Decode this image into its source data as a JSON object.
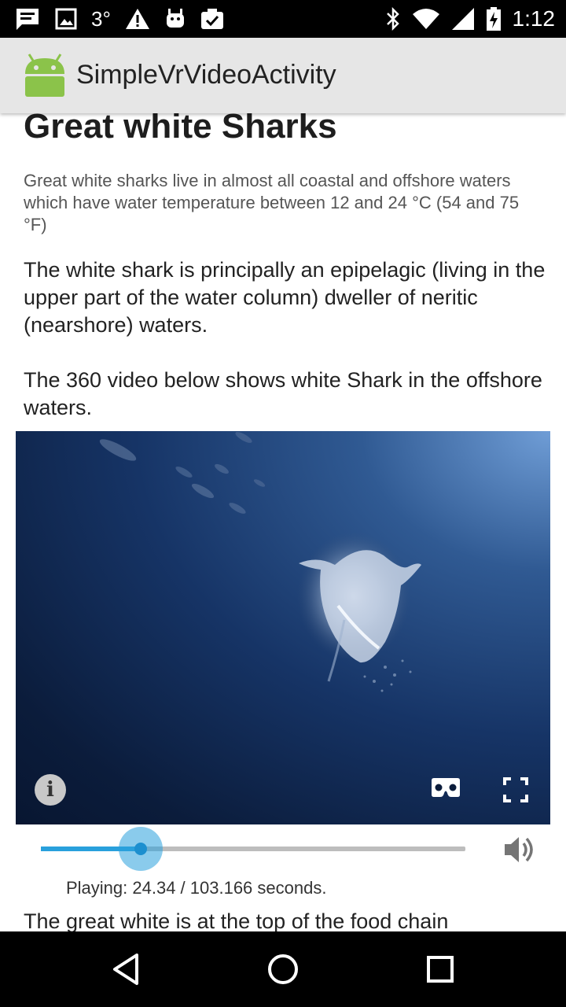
{
  "status_bar": {
    "temperature": "3°",
    "time": "1:12",
    "left_icons": [
      "message-icon",
      "image-icon",
      "warning-icon",
      "android-icon",
      "clipboard-check-icon"
    ],
    "right_icons": [
      "bluetooth-icon",
      "wifi-icon",
      "cell-signal-icon",
      "battery-charging-icon"
    ]
  },
  "app_bar": {
    "title": "SimpleVrVideoActivity",
    "logo": "android-logo-icon"
  },
  "article": {
    "headline": "Great white Sharks",
    "subtext": "Great white sharks live in almost all coastal and offshore waters which have water temperature between 12 and 24 °C (54 and 75 °F)",
    "paragraph1": "The white shark is principally an epipelagic (living in the upper part of the water column) dweller of neritic (nearshore) waters.",
    "paragraph2": "The 360 video below shows white Shark in the offshore waters.",
    "paragraph3": "The great white is at the top of the food chain"
  },
  "video": {
    "info_label": "i",
    "controls": [
      "info-icon",
      "cardboard-vr-icon",
      "fullscreen-icon"
    ],
    "current_seconds": 24.34,
    "total_seconds": 103.166,
    "progress_fraction": 0.236,
    "status": "Playing: 24.34 / 103.166 seconds.",
    "accent_color": "#29a0dc"
  },
  "nav_bar": {
    "buttons": [
      "back-icon",
      "home-icon",
      "recents-icon"
    ]
  }
}
